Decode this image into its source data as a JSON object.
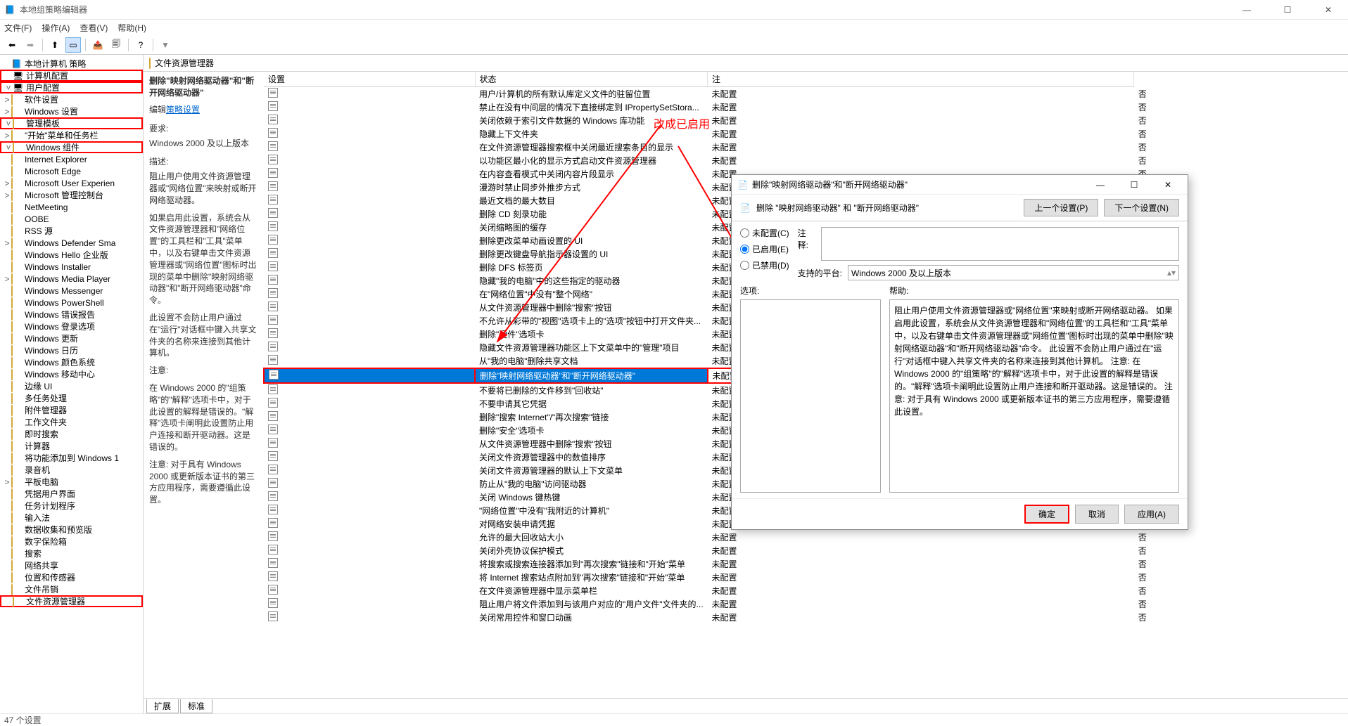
{
  "window": {
    "title": "本地组策略编辑器",
    "min": "—",
    "max": "☐",
    "close": "✕"
  },
  "menu": [
    "文件(F)",
    "操作(A)",
    "查看(V)",
    "帮助(H)"
  ],
  "status": "47 个设置",
  "breadcrumb": "文件资源管理器",
  "tree": [
    {
      "lv": 1,
      "exp": "",
      "txt": "本地计算机 策略",
      "kind": "root"
    },
    {
      "lv": 2,
      "exp": "",
      "txt": "计算机配置",
      "kind": "comp",
      "box": true
    },
    {
      "lv": 2,
      "exp": "˅",
      "txt": "用户配置",
      "kind": "user",
      "box": true
    },
    {
      "lv": 3,
      "exp": ">",
      "txt": "软件设置"
    },
    {
      "lv": 3,
      "exp": ">",
      "txt": "Windows 设置"
    },
    {
      "lv": 3,
      "exp": "˅",
      "txt": "管理模板",
      "box": true
    },
    {
      "lv": 4,
      "exp": ">",
      "txt": "\"开始\"菜单和任务栏"
    },
    {
      "lv": 4,
      "exp": "˅",
      "txt": "Windows 组件",
      "box": true
    },
    {
      "lv": 5,
      "exp": "",
      "txt": "Internet Explorer"
    },
    {
      "lv": 5,
      "exp": "",
      "txt": "Microsoft Edge"
    },
    {
      "lv": 5,
      "exp": ">",
      "txt": "Microsoft User Experien"
    },
    {
      "lv": 5,
      "exp": ">",
      "txt": "Microsoft 管理控制台"
    },
    {
      "lv": 5,
      "exp": "",
      "txt": "NetMeeting"
    },
    {
      "lv": 5,
      "exp": "",
      "txt": "OOBE"
    },
    {
      "lv": 5,
      "exp": "",
      "txt": "RSS 源"
    },
    {
      "lv": 5,
      "exp": ">",
      "txt": "Windows Defender Sma"
    },
    {
      "lv": 5,
      "exp": "",
      "txt": "Windows Hello 企业版"
    },
    {
      "lv": 5,
      "exp": "",
      "txt": "Windows Installer"
    },
    {
      "lv": 5,
      "exp": ">",
      "txt": "Windows Media Player"
    },
    {
      "lv": 5,
      "exp": "",
      "txt": "Windows Messenger"
    },
    {
      "lv": 5,
      "exp": "",
      "txt": "Windows PowerShell"
    },
    {
      "lv": 5,
      "exp": "",
      "txt": "Windows 错误报告"
    },
    {
      "lv": 5,
      "exp": "",
      "txt": "Windows 登录选项"
    },
    {
      "lv": 5,
      "exp": "",
      "txt": "Windows 更新"
    },
    {
      "lv": 5,
      "exp": "",
      "txt": "Windows 日历"
    },
    {
      "lv": 5,
      "exp": "",
      "txt": "Windows 颜色系统"
    },
    {
      "lv": 5,
      "exp": "",
      "txt": "Windows 移动中心"
    },
    {
      "lv": 5,
      "exp": "",
      "txt": "边缘 UI"
    },
    {
      "lv": 5,
      "exp": "",
      "txt": "多任务处理"
    },
    {
      "lv": 5,
      "exp": "",
      "txt": "附件管理器"
    },
    {
      "lv": 5,
      "exp": "",
      "txt": "工作文件夹"
    },
    {
      "lv": 5,
      "exp": "",
      "txt": "即时搜索"
    },
    {
      "lv": 5,
      "exp": "",
      "txt": "计算器"
    },
    {
      "lv": 5,
      "exp": "",
      "txt": "将功能添加到 Windows 1"
    },
    {
      "lv": 5,
      "exp": "",
      "txt": "录音机"
    },
    {
      "lv": 5,
      "exp": ">",
      "txt": "平板电脑"
    },
    {
      "lv": 5,
      "exp": "",
      "txt": "凭据用户界面"
    },
    {
      "lv": 5,
      "exp": "",
      "txt": "任务计划程序"
    },
    {
      "lv": 5,
      "exp": "",
      "txt": "输入法"
    },
    {
      "lv": 5,
      "exp": "",
      "txt": "数据收集和预览版"
    },
    {
      "lv": 5,
      "exp": "",
      "txt": "数字保险箱"
    },
    {
      "lv": 5,
      "exp": "",
      "txt": "搜索"
    },
    {
      "lv": 5,
      "exp": "",
      "txt": "网络共享"
    },
    {
      "lv": 5,
      "exp": "",
      "txt": "位置和传感器"
    },
    {
      "lv": 5,
      "exp": "",
      "txt": "文件吊销"
    },
    {
      "lv": 5,
      "exp": "",
      "txt": "文件资源管理器",
      "box": true
    }
  ],
  "desc": {
    "title": "删除\"映射网络驱动器\"和\"断开网络驱动器\"",
    "editl": "编辑",
    "editlink": "策略设置",
    "req_l": "要求:",
    "req": "Windows 2000 及以上版本",
    "sum_l": "描述:",
    "p1": "阻止用户使用文件资源管理器或\"网络位置\"来映射或断开网络驱动器。",
    "p2": "如果启用此设置，系统会从文件资源管理器和\"网络位置\"的工具栏和\"工具\"菜单中，以及右键单击文件资源管理器或\"网络位置\"图标时出现的菜单中删除\"映射网络驱动器\"和\"断开网络驱动器\"命令。",
    "p3": "此设置不会防止用户通过在\"运行\"对话框中键入共享文件夹的名称来连接到其他计算机。",
    "note_l": "注意:",
    "p4": "在 Windows 2000 的\"组策略\"的\"解释\"选项卡中，对于此设置的解释是错误的。\"解释\"选项卡阐明此设置防止用户连接和断开驱动器。这是错误的。",
    "p5": "注意: 对于具有 Windows 2000 或更新版本证书的第三方应用程序，需要遵循此设置。"
  },
  "cols": {
    "c1": "设置",
    "c2": "状态",
    "c3": "注"
  },
  "common": {
    "state": "未配置",
    "ov": "否"
  },
  "policies": [
    "用户/计算机的所有默认库定义文件的驻留位置",
    "禁止在没有中间层的情况下直接绑定到 IPropertySetStora...",
    "关闭依赖于索引文件数据的 Windows 库功能",
    "隐藏上下文件夹",
    "在文件资源管理器搜索框中关闭最近搜索条目的显示",
    "以功能区最小化的显示方式启动文件资源管理器",
    "在内容查看模式中关闭内容片段显示",
    "漫游时禁止同步外推步方式",
    "最近文档的最大数目",
    "删除 CD 刻录功能",
    "关闭缩略图的缓存",
    "删除更改菜单动画设置的 UI",
    "删除更改键盘导航指示器设置的 UI",
    "删除 DFS 标签页",
    "隐藏\"我的电脑\"中的这些指定的驱动器",
    "在\"网络位置\"中没有\"整个网络\"",
    "从文件资源管理器中删除\"搜索\"按钮",
    "不允许从彩带的\"视图\"选项卡上的\"选项\"按钮中打开文件夹...",
    "删除\"硬件\"选项卡",
    "隐藏文件资源管理器功能区上下文菜单中的\"管理\"项目",
    "从\"我的电脑\"删除共享文档",
    "删除\"映射网络驱动器\"和\"断开网络驱动器\"",
    "不要将已删除的文件移到\"回收站\"",
    "不要申请其它凭据",
    "删除\"搜索 Internet\"/\"再次搜索\"链接",
    "删除\"安全\"选项卡",
    "从文件资源管理器中删除\"搜索\"按钮",
    "关闭文件资源管理器中的数值排序",
    "关闭文件资源管理器的默认上下文菜单",
    "防止从\"我的电脑\"访问驱动器",
    "关闭 Windows 键热键",
    "\"网络位置\"中没有\"我附近的计算机\"",
    "对网络安装申请凭据",
    "允许的最大回收站大小",
    "关闭外壳协议保护模式",
    "将搜索或搜索连接器添加到\"再次搜索\"链接和\"开始\"菜单",
    "将 Internet 搜索站点附加到\"再次搜索\"链接和\"开始\"菜单",
    "在文件资源管理器中显示菜单栏",
    "阻止用户将文件添加到与该用户对应的\"用户文件\"文件夹的...",
    "关闭常用控件和窗口动画"
  ],
  "tabs": {
    "t1": "扩展",
    "t2": "标准"
  },
  "dialog": {
    "title": "删除\"映射网络驱动器\"和\"断开网络驱动器\"",
    "head": "删除 \"映射网络驱动器\" 和 \"断开网络驱动器\"",
    "prev": "上一个设置(P)",
    "next": "下一个设置(N)",
    "r1": "未配置(C)",
    "r2": "已启用(E)",
    "r3": "已禁用(D)",
    "comment_l": "注释:",
    "platform_l": "支持的平台:",
    "platform": "Windows 2000 及以上版本",
    "opts_l": "选项:",
    "help_l": "帮助:",
    "help": "阻止用户使用文件资源管理器或\"网络位置\"来映射或断开网络驱动器。\n\n如果启用此设置，系统会从文件资源管理器和\"网络位置\"的工具栏和\"工具\"菜单中，以及右键单击文件资源管理器或\"网络位置\"图标时出现的菜单中删除\"映射网络驱动器\"和\"断开网络驱动器\"命令。\n\n此设置不会防止用户通过在\"运行\"对话框中键入共享文件夹的名称来连接到其他计算机。\n\n注意:\n\n在 Windows 2000 的\"组策略\"的\"解释\"选项卡中，对于此设置的解释是错误的。\"解释\"选项卡阐明此设置防止用户连接和断开驱动器。这是错误的。\n\n注意: 对于具有 Windows 2000 或更新版本证书的第三方应用程序，需要遵循此设置。",
    "ok": "确定",
    "cancel": "取消",
    "apply": "应用(A)"
  },
  "annot": "改成已启用"
}
